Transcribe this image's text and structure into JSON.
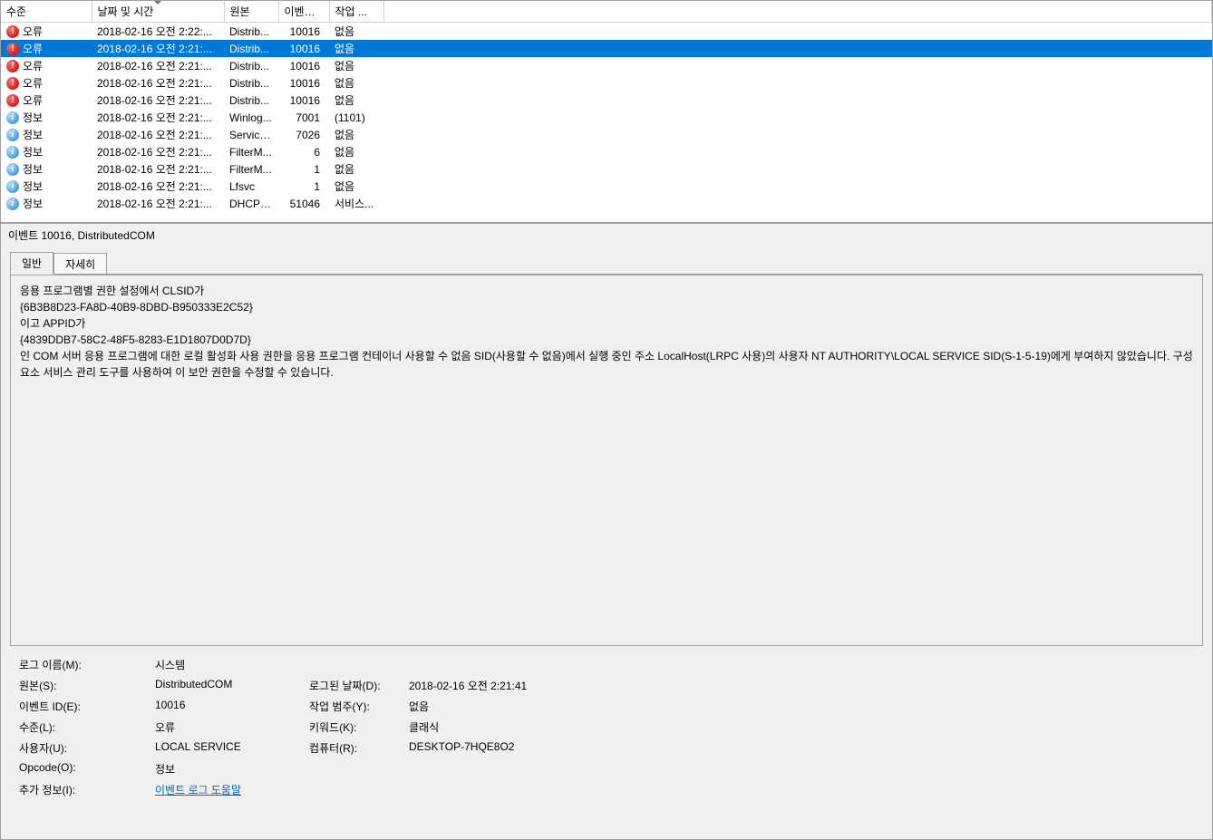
{
  "columns": {
    "level": "수준",
    "date": "날짜 및 시간",
    "source": "원본",
    "eventid": "이벤트...",
    "task": "작업 ..."
  },
  "events": [
    {
      "icon": "error",
      "level": "오류",
      "date": "2018-02-16 오전 2:22:...",
      "source": "Distrib...",
      "eventid": "10016",
      "task": "없음",
      "selected": false
    },
    {
      "icon": "error",
      "level": "오류",
      "date": "2018-02-16 오전 2:21:...",
      "source": "Distrib...",
      "eventid": "10016",
      "task": "없음",
      "selected": true
    },
    {
      "icon": "error",
      "level": "오류",
      "date": "2018-02-16 오전 2:21:...",
      "source": "Distrib...",
      "eventid": "10016",
      "task": "없음",
      "selected": false
    },
    {
      "icon": "error",
      "level": "오류",
      "date": "2018-02-16 오전 2:21:...",
      "source": "Distrib...",
      "eventid": "10016",
      "task": "없음",
      "selected": false
    },
    {
      "icon": "error",
      "level": "오류",
      "date": "2018-02-16 오전 2:21:...",
      "source": "Distrib...",
      "eventid": "10016",
      "task": "없음",
      "selected": false
    },
    {
      "icon": "info",
      "level": "정보",
      "date": "2018-02-16 오전 2:21:...",
      "source": "Winlog...",
      "eventid": "7001",
      "task": "(1101)",
      "selected": false
    },
    {
      "icon": "info",
      "level": "정보",
      "date": "2018-02-16 오전 2:21:...",
      "source": "Service...",
      "eventid": "7026",
      "task": "없음",
      "selected": false
    },
    {
      "icon": "info",
      "level": "정보",
      "date": "2018-02-16 오전 2:21:...",
      "source": "FilterM...",
      "eventid": "6",
      "task": "없음",
      "selected": false
    },
    {
      "icon": "info",
      "level": "정보",
      "date": "2018-02-16 오전 2:21:...",
      "source": "FilterM...",
      "eventid": "1",
      "task": "없음",
      "selected": false
    },
    {
      "icon": "info",
      "level": "정보",
      "date": "2018-02-16 오전 2:21:...",
      "source": "Lfsvc",
      "eventid": "1",
      "task": "없음",
      "selected": false
    },
    {
      "icon": "info",
      "level": "정보",
      "date": "2018-02-16 오전 2:21:...",
      "source": "DHCPv...",
      "eventid": "51046",
      "task": "서비스...",
      "selected": false
    }
  ],
  "detail": {
    "title": "이벤트 10016, DistributedCOM",
    "tabs": {
      "general": "일반",
      "details": "자세히"
    },
    "description": "응용 프로그램별 권한 설정에서 CLSID가\n{6B3B8D23-FA8D-40B9-8DBD-B950333E2C52}\n이고 APPID가\n{4839DDB7-58C2-48F5-8283-E1D1807D0D7D}\n인 COM 서버 응용 프로그램에 대한 로컬 활성화 사용 권한을 응용 프로그램 컨테이너 사용할 수 없음 SID(사용할 수 없음)에서 실행 중인 주소 LocalHost(LRPC 사용)의 사용자 NT AUTHORITY\\LOCAL SERVICE SID(S-1-5-19)에게 부여하지 않았습니다. 구성 요소 서비스 관리 도구를 사용하여 이 보안 권한을 수정할 수 있습니다.",
    "props": {
      "logname_label": "로그 이름(M):",
      "logname": "시스템",
      "source_label": "원본(S):",
      "source": "DistributedCOM",
      "logged_label": "로그된 날짜(D):",
      "logged": "2018-02-16 오전 2:21:41",
      "eventid_label": "이벤트 ID(E):",
      "eventid": "10016",
      "taskcat_label": "작업 범주(Y):",
      "taskcat": "없음",
      "level_label": "수준(L):",
      "level": "오류",
      "keywords_label": "키워드(K):",
      "keywords": "클래식",
      "user_label": "사용자(U):",
      "user": "LOCAL SERVICE",
      "computer_label": "컴퓨터(R):",
      "computer": "DESKTOP-7HQE8O2",
      "opcode_label": "Opcode(O):",
      "opcode": "정보",
      "moreinfo_label": "추가 정보(I):",
      "moreinfo": "이벤트 로그 도움말"
    }
  }
}
